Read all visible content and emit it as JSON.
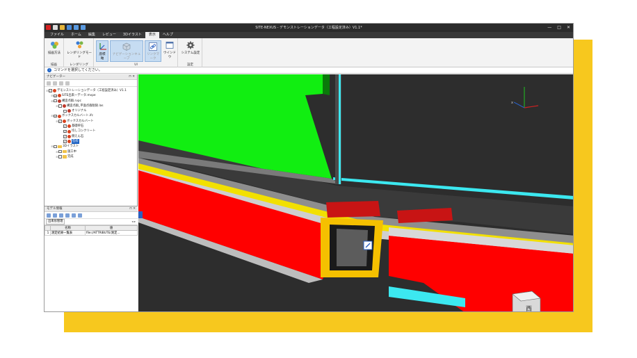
{
  "app": {
    "title": "SITE-NEXUS - デモンストレーションデータ（工程設定済み）V1.1*",
    "window_controls": [
      "—",
      "□",
      "✕"
    ]
  },
  "menu": {
    "items": [
      "ファイル",
      "ホーム",
      "編集",
      "レビュー",
      "3Dイラスト",
      "表示",
      "ヘルプ"
    ],
    "active": "表示"
  },
  "ribbon": {
    "groups": [
      {
        "name": "描画",
        "buttons": [
          "描画方法"
        ]
      },
      {
        "name": "レンダリング",
        "buttons": [
          "レンダリングモード"
        ]
      },
      {
        "name": "UI",
        "buttons": [
          "座標軸",
          "ナビゲーションキューブ",
          "リンクマーク",
          "ウインドウ"
        ]
      },
      {
        "name": "設定",
        "buttons": [
          "システム設定"
        ]
      }
    ]
  },
  "command_bar": {
    "text": "コマンドを選択してください。",
    "icon": "info-icon"
  },
  "left_pane": {
    "title": "ナビゲーター",
    "tree": [
      {
        "label": "デモンストレーションデータ（工程設定済み）V1.1",
        "level": 0,
        "kind": "root",
        "checked": true
      },
      {
        "label": "SITE出来ーデータ.mvpe",
        "level": 1,
        "kind": "file",
        "checked": true
      },
      {
        "label": "構造点群.rvpc",
        "level": 1,
        "kind": "pc",
        "checked": false
      },
      {
        "label": "構造点群_平面点群削除.las",
        "level": 2,
        "kind": "pc",
        "checked": false
      },
      {
        "label": "オリジナル",
        "level": 3,
        "kind": "pc",
        "checked": false
      },
      {
        "label": "ボックスカルバート.ifc",
        "level": 1,
        "kind": "file",
        "checked": true
      },
      {
        "label": "ボックスカルバート",
        "level": 2,
        "kind": "file",
        "checked": true
      },
      {
        "label": "基礎砕石",
        "level": 3,
        "kind": "file",
        "checked": true
      },
      {
        "label": "均しコンクリート",
        "level": 3,
        "kind": "file",
        "checked": true
      },
      {
        "label": "側えん石",
        "level": 3,
        "kind": "file",
        "checked": true
      },
      {
        "label": "型枠",
        "level": 3,
        "kind": "file",
        "checked": true,
        "selected": true
      },
      {
        "label": "3Dイラスト",
        "level": 1,
        "kind": "folder",
        "checked": false
      },
      {
        "label": "施工中",
        "level": 2,
        "kind": "folder",
        "checked": false
      },
      {
        "label": "完成",
        "level": 2,
        "kind": "folder",
        "checked": false
      }
    ]
  },
  "model_pane": {
    "title": "モデル情報",
    "tab": "出来形管理",
    "columns": [
      "名称",
      "値"
    ],
    "rows": [
      {
        "idx": "1",
        "name": "測定結果一覧表",
        "value": "file://ATTRIBUTE/測定..."
      }
    ]
  },
  "colors": {
    "accent": "#1e63c4",
    "red": "#ff0000",
    "yellow": "#f7e000",
    "green": "#10ee10",
    "cyan": "#3ce8f0"
  }
}
